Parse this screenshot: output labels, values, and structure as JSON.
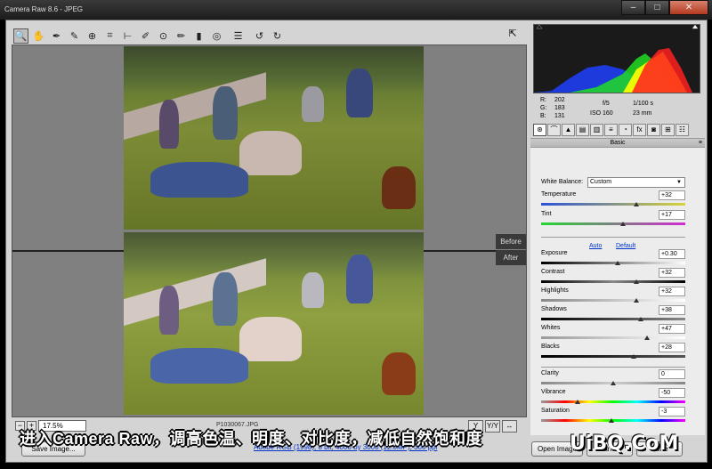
{
  "window": {
    "title": "Camera Raw 8.6  -  JPEG",
    "minimize": "–",
    "maximize": "□",
    "close": "✕"
  },
  "toolbar": {
    "tools": [
      {
        "name": "zoom-tool-icon",
        "glyph": "🔍"
      },
      {
        "name": "hand-tool-icon",
        "glyph": "✋"
      },
      {
        "name": "white-balance-tool-icon",
        "glyph": "✒"
      },
      {
        "name": "color-sampler-tool-icon",
        "glyph": "✎"
      },
      {
        "name": "targeted-adjustment-tool-icon",
        "glyph": "⊕"
      },
      {
        "name": "crop-tool-icon",
        "glyph": "⌗"
      },
      {
        "name": "straighten-tool-icon",
        "glyph": "⊢"
      },
      {
        "name": "spot-removal-tool-icon",
        "glyph": "✐"
      },
      {
        "name": "red-eye-tool-icon",
        "glyph": "⊙"
      },
      {
        "name": "adjustment-brush-icon",
        "glyph": "✏"
      },
      {
        "name": "graduated-filter-icon",
        "glyph": "▮"
      },
      {
        "name": "radial-filter-icon",
        "glyph": "◎"
      },
      {
        "name": "preferences-icon",
        "glyph": "☰"
      },
      {
        "name": "rotate-left-icon",
        "glyph": "↺"
      },
      {
        "name": "rotate-right-icon",
        "glyph": "↻"
      }
    ],
    "fullscreen_glyph": "⇱"
  },
  "preview": {
    "before_label": "Before",
    "after_label": "After"
  },
  "bottom": {
    "zoom_minus": "−",
    "zoom_plus": "+",
    "zoom_value": "17.5%",
    "filename": "P1030067.JPG",
    "views": [
      "Y",
      "Y/Y",
      "↔",
      "⚙"
    ]
  },
  "footer": {
    "save_button": "Save Image...",
    "workflow_link": "Adobe RGB (1998); 8 bit; 4000 by 3000 (12.0MP); 300 ppi",
    "open_button": "Open Image",
    "cancel_button": "Cancel",
    "done_button": "Done"
  },
  "caption": "进入Camera Raw，调高色温、明度、对比度，减低自然饱和度",
  "watermark": "UiBQ.CoM",
  "histogram": {
    "colors": {
      "red": "#ff2020",
      "green": "#22dd22",
      "blue": "#2040ff",
      "yellow": "#ffff00"
    }
  },
  "readout": {
    "r_label": "R:",
    "r_value": "202",
    "g_label": "G:",
    "g_value": "183",
    "b_label": "B:",
    "b_value": "131",
    "aperture": "f/5",
    "shutter": "1/100 s",
    "iso": "ISO 160",
    "focal": "23 mm"
  },
  "panel_tabs": [
    "⊛",
    "⌒",
    "▲",
    "▤",
    "▥",
    "≡",
    "◔",
    "fx",
    "◙",
    "⊞",
    "☷"
  ],
  "panel": {
    "title": "Basic",
    "menu_icon": "≡",
    "white_balance_label": "White Balance:",
    "white_balance_value": "Custom",
    "select_arrow": "▼",
    "auto_link": "Auto",
    "default_link": "Default",
    "sliders": [
      {
        "label": "Temperature",
        "value": "+32",
        "fraction": 0.66,
        "gradient": "linear-gradient(90deg,#2c52d8,#d9d33a)"
      },
      {
        "label": "Tint",
        "value": "+17",
        "fraction": 0.57,
        "gradient": "linear-gradient(90deg,#25d631,#d22bd1)"
      },
      {
        "label": "Exposure",
        "value": "+0.30",
        "fraction": 0.53,
        "gradient": "linear-gradient(90deg,#000,#fff)"
      },
      {
        "label": "Contrast",
        "value": "+32",
        "fraction": 0.66,
        "gradient": "linear-gradient(90deg,#000,#888,#000)"
      },
      {
        "label": "Highlights",
        "value": "+32",
        "fraction": 0.66,
        "gradient": "linear-gradient(90deg,#888,#fff)"
      },
      {
        "label": "Shadows",
        "value": "+38",
        "fraction": 0.69,
        "gradient": "linear-gradient(90deg,#000,#888)"
      },
      {
        "label": "Whites",
        "value": "+47",
        "fraction": 0.735,
        "gradient": "linear-gradient(90deg,#999,#fff)"
      },
      {
        "label": "Blacks",
        "value": "+28",
        "fraction": 0.64,
        "gradient": "linear-gradient(90deg,#000,#555)"
      },
      {
        "label": "Clarity",
        "value": "0",
        "fraction": 0.5,
        "gradient": "linear-gradient(90deg,#888,#ccc,#888)"
      },
      {
        "label": "Vibrance",
        "value": "-50",
        "fraction": 0.25,
        "gradient": "linear-gradient(90deg,#999,#f00,#ff0,#0f0,#0ff,#00f,#f0f)"
      },
      {
        "label": "Saturation",
        "value": "-3",
        "fraction": 0.485,
        "gradient": "linear-gradient(90deg,#999,#f00,#ff0,#0f0,#0ff,#00f,#f0f)"
      }
    ]
  }
}
